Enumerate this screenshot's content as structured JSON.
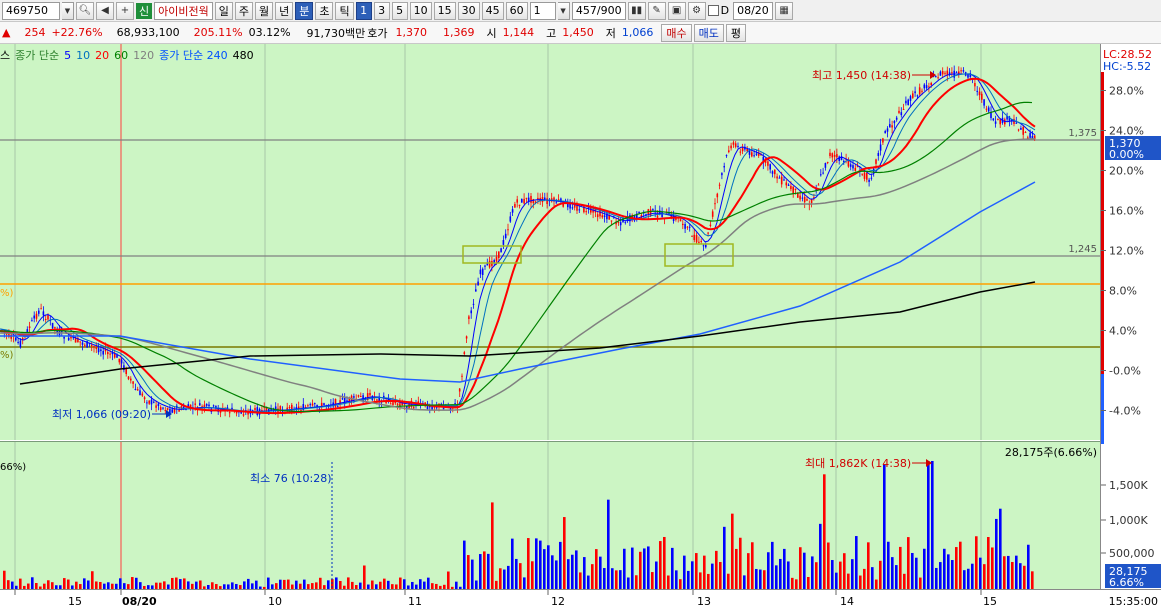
{
  "toolbar": {
    "stock_code": "469750",
    "credit_badge": "신",
    "stock_name": "아이비전웍",
    "periods": [
      "일",
      "주",
      "월",
      "년",
      "분",
      "초",
      "틱"
    ],
    "active_period": "분",
    "intervals": [
      "1",
      "3",
      "5",
      "10",
      "15",
      "30",
      "45",
      "60"
    ],
    "active_interval": "1",
    "multiplier": "1",
    "count": "457/900",
    "d_label": "D",
    "date": "08/20"
  },
  "quote": {
    "arrow": "▲",
    "change": "254",
    "change_pct": "+22.76%",
    "volume": "68,933,100",
    "volume_ratio": "205.11%",
    "turnover": "03.12%",
    "amount": "91,730백만",
    "bid_label": "호가",
    "ask_price": "1,370",
    "bid_price": "1,369",
    "open_label": "시",
    "open": "1,144",
    "high_label": "고",
    "high": "1,450",
    "low_label": "저",
    "low": "1,066",
    "buy_button": "매수",
    "sell_button": "매도",
    "flat_button": "평"
  },
  "legend": {
    "prefix": "스",
    "ma_label": "종가 단순",
    "ma_periods": [
      "5",
      "10",
      "20",
      "60",
      "120"
    ],
    "ma_colors": [
      "#0000ff",
      "#0070c0",
      "#ff0000",
      "#008000",
      "#808080"
    ],
    "ma_long_label": "종가 단순 240",
    "ma_long_color": "#0050ff",
    "ma_long2": "480"
  },
  "chart_data": {
    "type": "candlestick",
    "price_axis": {
      "ticks": [
        "28.0%",
        "24.0%",
        "20.0%",
        "16.0%",
        "12.0%",
        "8.0%",
        "4.0%",
        "-0.0%",
        "-4.0%"
      ],
      "top_labels": [
        "LC:28.52",
        "HC:-5.52"
      ],
      "current_price": "1,370",
      "current_change": "0.00%",
      "ref_levels": [
        "1,375",
        "1,245"
      ],
      "left_cut_labels": [
        "%)",
        "%)"
      ]
    },
    "volume_axis": {
      "ticks": [
        "1,500K",
        "1,000K",
        "500,000"
      ],
      "current_volume": "28,175",
      "current_pct": "6.66%",
      "header": "28,175주(6.66%)",
      "left_cut": "66%)"
    },
    "date_axis": {
      "labels": [
        "15",
        "08/20",
        "10",
        "11",
        "12",
        "13",
        "14",
        "15"
      ],
      "end_time": "15:35:00"
    },
    "annotations": {
      "high": "최고 1,450 (14:38)",
      "low": "최저 1,066 (09:20)",
      "max_volume": "최대 1,862K (14:38)",
      "min_volume": "최소 76 (10:28)"
    },
    "up_color": "#ff0000",
    "down_color": "#0000ff"
  }
}
